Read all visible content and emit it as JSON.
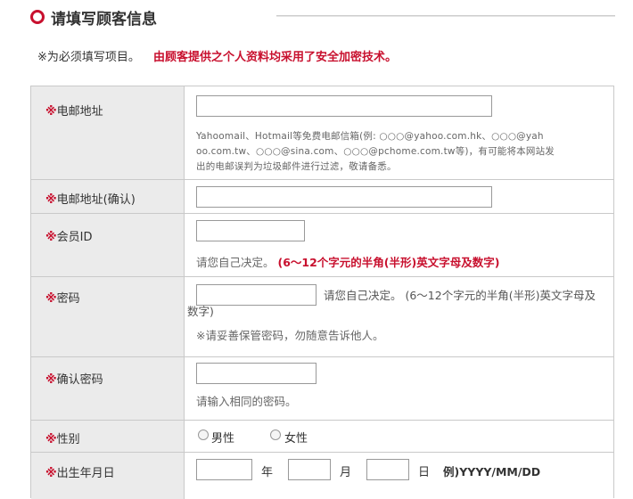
{
  "header": {
    "title": "请填写顾客信息"
  },
  "notice": {
    "required_note": "※为必须填写项目。",
    "security_note": "由顾客提供之个人资料均采用了安全加密技术。"
  },
  "required_mark": "※",
  "fields": {
    "email": {
      "label": "电邮地址",
      "value": "",
      "help_line1": "Yahoomail、Hotmail等免费电邮信箱(例: ○○○@yahoo.com.hk、○○○@yah",
      "help_line2": "oo.com.tw、○○○@sina.com、○○○@pchome.com.tw等)，有可能将本网站发",
      "help_line3": "出的电邮误判为垃圾邮件进行过滤，敬请备悉。"
    },
    "email_confirm": {
      "label": "电邮地址(确认)",
      "value": ""
    },
    "member_id": {
      "label": "会员ID",
      "value": "",
      "help": "请您自己决定。",
      "help_rule": "(6～12个字元的半角(半形)英文字母及数字)"
    },
    "password": {
      "label": "密码",
      "value": "",
      "help_line1": "请您自己决定。  (6～12个字元的半角(半形)英文字母及",
      "help_line2": "数字)",
      "help_note": "※请妥善保管密码，勿随意告诉他人。"
    },
    "password_confirm": {
      "label": "确认密码",
      "value": "",
      "help": "请输入相同的密码。"
    },
    "gender": {
      "label": "性别",
      "options": [
        "男性",
        "女性"
      ]
    },
    "birthdate": {
      "label": "出生年月日",
      "year_value": "",
      "year_unit": "年",
      "month_value": "",
      "month_unit": "月",
      "day_value": "",
      "day_unit": "日",
      "format_hint": "例)YYYY/MM/DD"
    }
  },
  "colors": {
    "accent": "#c8102e",
    "label_bg": "#ebebeb",
    "border": "#c9c9c9"
  }
}
